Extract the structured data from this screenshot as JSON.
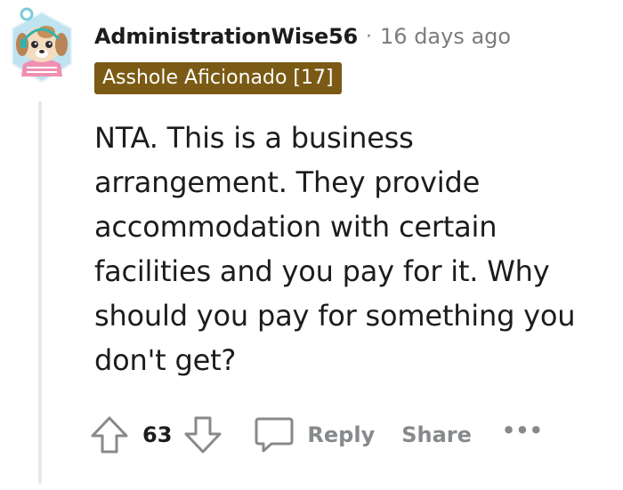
{
  "comment": {
    "username": "AdministrationWise56",
    "separator": "·",
    "timestamp": "16 days ago",
    "flair": "Asshole Aficionado [17]",
    "body_lines": [
      "NTA. This is a business",
      "arrangement. They provide",
      "accommodation with certain",
      "facilities and you pay for it. Why",
      "should you pay for something you",
      "don't get?"
    ]
  },
  "actions": {
    "score": "63",
    "reply_label": "Reply",
    "share_label": "Share",
    "more_label": "•••"
  },
  "icons": {
    "upvote": "upvote-arrow-icon",
    "downvote": "downvote-arrow-icon",
    "reply": "speech-bubble-icon",
    "more": "ellipsis-icon",
    "avatar": "dog-avatar-icon"
  },
  "colors": {
    "flair_background": "#7a5a14",
    "text": "#1c1c1c",
    "muted": "#878a8c",
    "thread_line": "#e8e8e8"
  }
}
